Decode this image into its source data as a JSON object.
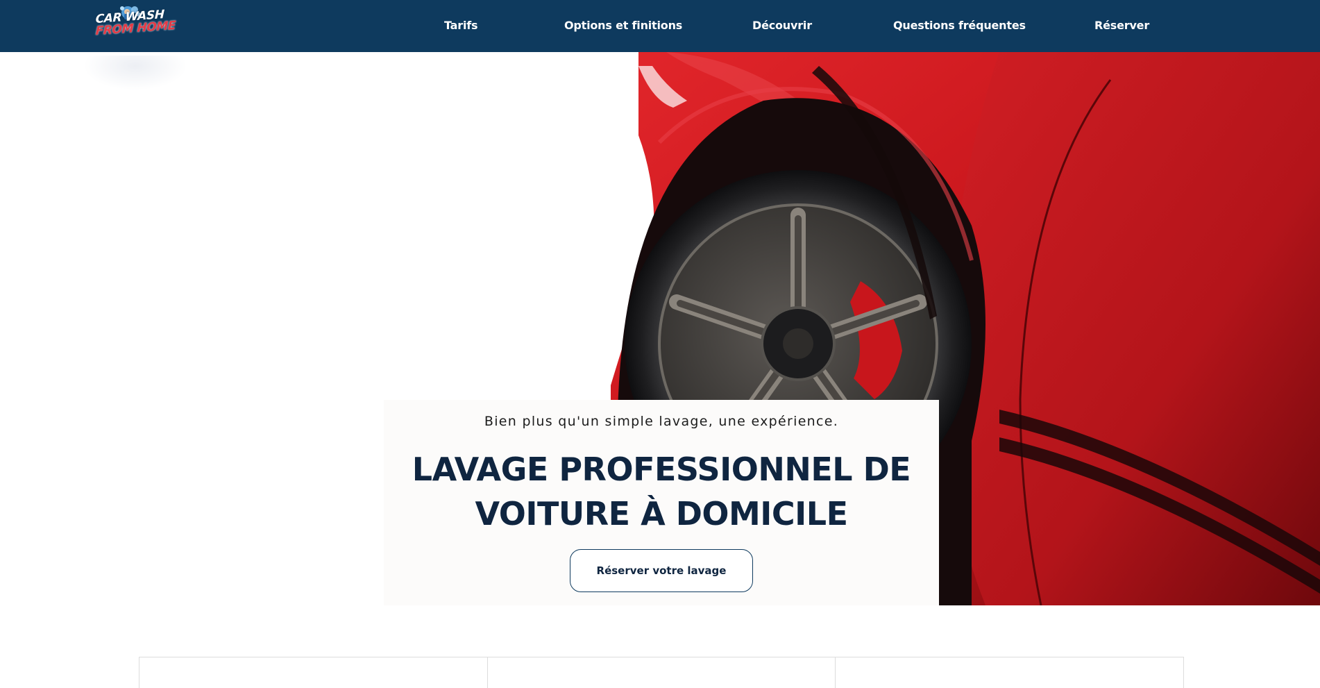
{
  "logo": {
    "line1": "CAR WASH",
    "line2": "FROM HOME",
    "icon": "car-wash-mascot-icon"
  },
  "nav": {
    "items": [
      {
        "label": "Tarifs"
      },
      {
        "label": "Options et finitions"
      },
      {
        "label": "Découvrir"
      },
      {
        "label": "Questions fréquentes"
      },
      {
        "label": "Réserver"
      }
    ]
  },
  "hero": {
    "image": "red-sports-car-wheel-image",
    "tagline": "Bien plus qu'un simple lavage, une expérience.",
    "title_line1": "LAVAGE PROFESSIONNEL DE",
    "title_line2": "VOITURE À DOMICILE",
    "cta_label": "Réserver votre lavage"
  },
  "colors": {
    "header_bg": "#0e3a5e",
    "nav_text": "#ffffff",
    "title_text": "#0f2540",
    "car_red": "#c4161c",
    "logo_red": "#e43a45"
  }
}
